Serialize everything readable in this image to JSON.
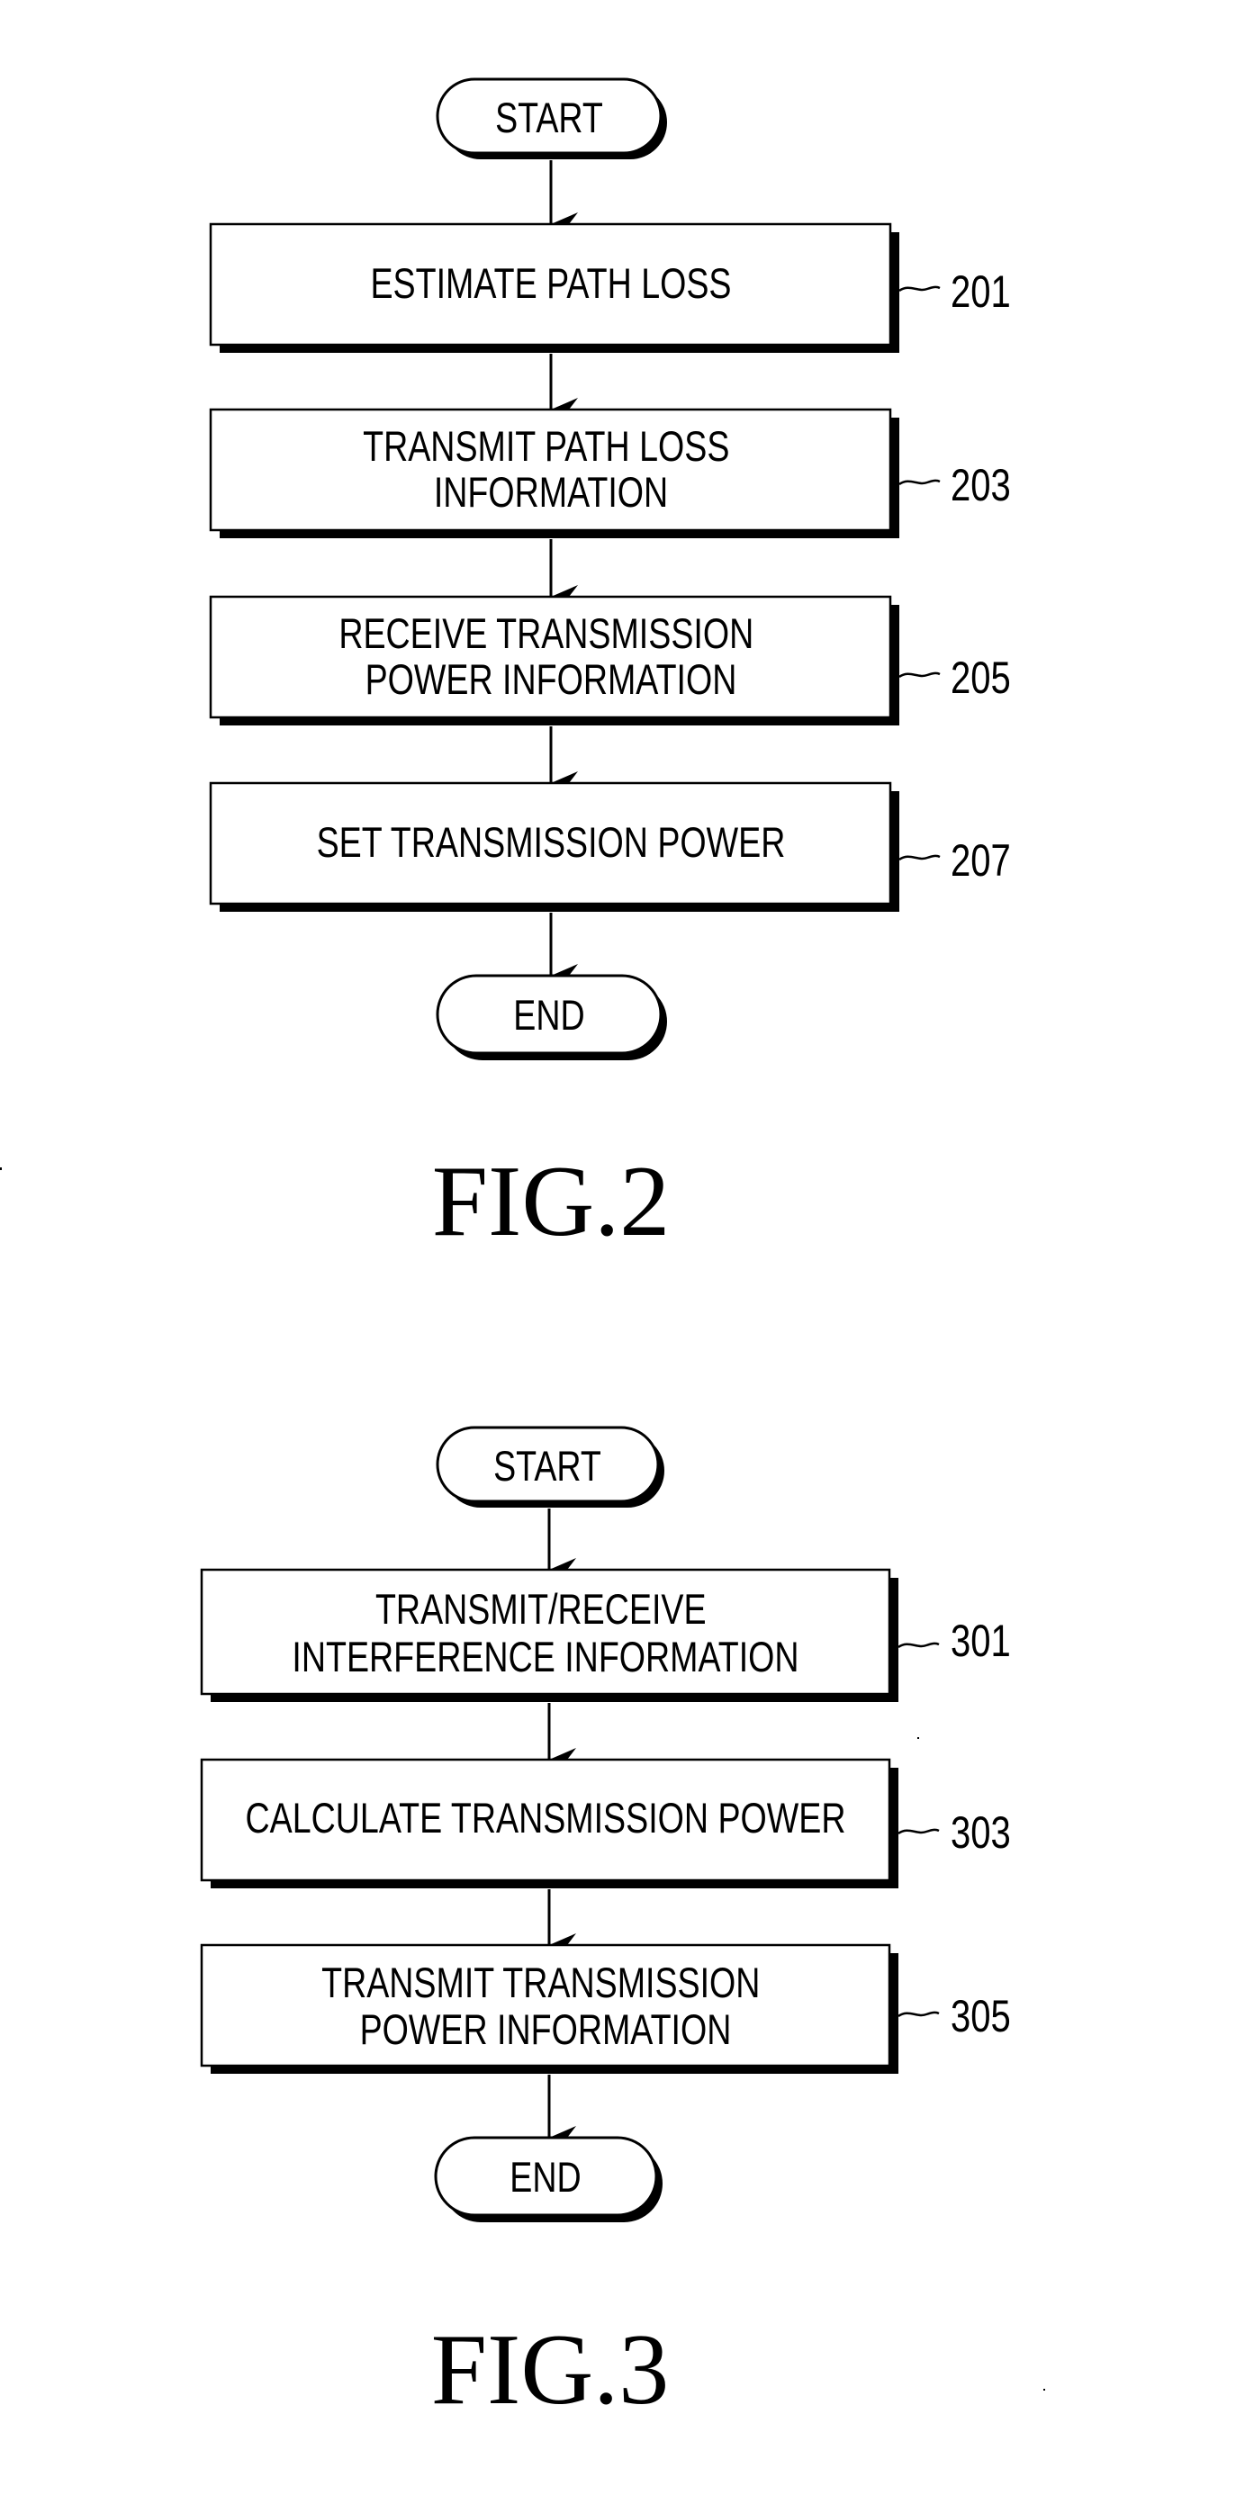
{
  "figures": [
    {
      "title": "FIG.2",
      "start_label": "START",
      "end_label": "END",
      "steps": [
        {
          "ref": "201",
          "lines": [
            "ESTIMATE PATH LOSS"
          ]
        },
        {
          "ref": "203",
          "lines": [
            "TRANSMIT PATH LOSS",
            "INFORMATION"
          ]
        },
        {
          "ref": "205",
          "lines": [
            "RECEIVE TRANSMISSION",
            "POWER INFORMATION"
          ]
        },
        {
          "ref": "207",
          "lines": [
            "SET TRANSMISSION POWER"
          ]
        }
      ]
    },
    {
      "title": "FIG.3",
      "start_label": "START",
      "end_label": "END",
      "steps": [
        {
          "ref": "301",
          "lines": [
            "TRANSMIT/RECEIVE",
            "INTERFERENCE INFORMATION"
          ]
        },
        {
          "ref": "303",
          "lines": [
            "CALCULATE TRANSMISSION POWER"
          ]
        },
        {
          "ref": "305",
          "lines": [
            "TRANSMIT TRANSMISSION",
            "POWER INFORMATION"
          ]
        }
      ]
    }
  ],
  "colors": {
    "ink": "#000000",
    "paper": "#ffffff"
  }
}
